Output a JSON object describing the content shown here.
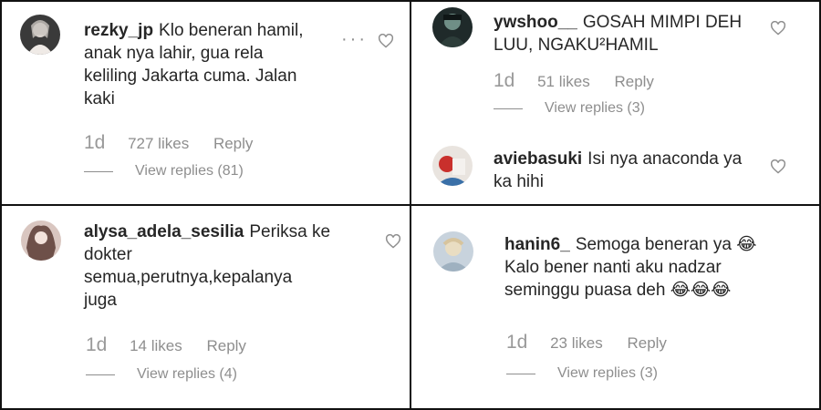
{
  "comments": [
    {
      "username": "rezky_jp",
      "text_lines": [
        "Klo beneran hamil,",
        "anak nya lahir, gua rela",
        "keliling Jakarta cuma. Jalan",
        "kaki"
      ],
      "time": "1d",
      "likes": "727 likes",
      "reply": "Reply",
      "view_replies": "View replies (81)",
      "more": "···"
    },
    {
      "username": "ywshoo__",
      "text_lines": [
        "GOSAH MIMPI DEH",
        "LUU, NGAKU²HAMIL"
      ],
      "time": "1d",
      "likes": "51 likes",
      "reply": "Reply",
      "view_replies": "View replies (3)"
    },
    {
      "username": "aviebasuki",
      "text_lines": [
        "Isi nya anaconda ya",
        "ka hihi"
      ]
    },
    {
      "username": "alysa_adela_sesilia",
      "text_lines": [
        "Periksa ke",
        "dokter",
        "semua,perutnya,kepalanya",
        "juga"
      ],
      "time": "1d",
      "likes": "14 likes",
      "reply": "Reply",
      "view_replies": "View replies (4)"
    },
    {
      "username": "hanin6_",
      "text_lines": [
        "Semoga beneran ya 😂",
        "Kalo bener nanti aku nadzar",
        "seminggu puasa deh 😂😂😂"
      ],
      "time": "1d",
      "likes": "23 likes",
      "reply": "Reply",
      "view_replies": "View replies (3)"
    }
  ],
  "icons": {
    "like": "heart-outline-icon",
    "more": "more-options-icon"
  },
  "colors": {
    "text": "#262626",
    "meta": "#8e8e8e",
    "divider": "#111111"
  }
}
